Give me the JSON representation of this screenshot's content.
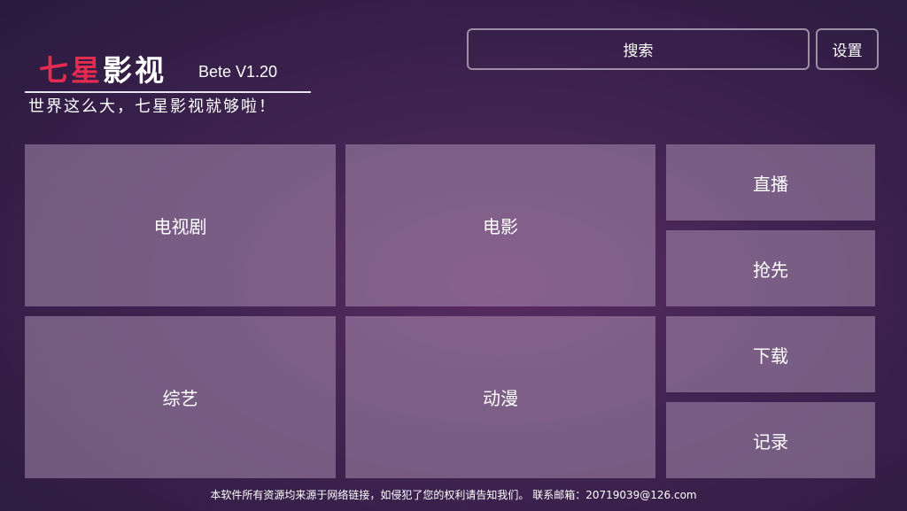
{
  "header": {
    "logo_part1": "七星",
    "logo_part2": "影视",
    "version": "Bete V1.20",
    "slogan": "世界这么大，七星影视就够啦！",
    "search_label": "搜索",
    "settings_label": "设置"
  },
  "tiles": {
    "tv_series": "电视剧",
    "movies": "电影",
    "variety": "综艺",
    "anime": "动漫",
    "live": "直播",
    "preview": "抢先",
    "download": "下载",
    "history": "记录"
  },
  "footer": {
    "text": "本软件所有资源均来源于网络链接，如侵犯了您的权利请告知我们。 联系邮箱：20719039@126.com"
  },
  "colors": {
    "logo_red": "#e52b50",
    "background": "#3f2350",
    "tile": "#7a6482"
  }
}
